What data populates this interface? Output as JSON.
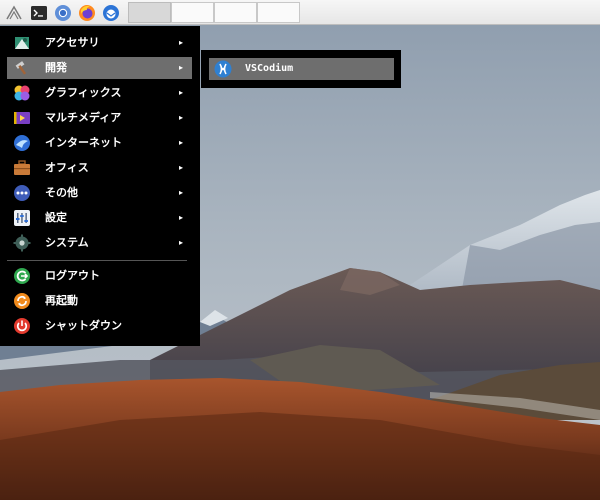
{
  "taskbar": {
    "launchers": [
      {
        "icon": "lxqt-logo-icon"
      },
      {
        "icon": "terminal-icon"
      },
      {
        "icon": "chromium-icon"
      },
      {
        "icon": "firefox-icon"
      },
      {
        "icon": "thunderbird-icon"
      }
    ],
    "tasks": [
      {
        "state": "active"
      },
      {
        "state": "inactive"
      },
      {
        "state": "inactive"
      },
      {
        "state": "inactive"
      }
    ]
  },
  "menu": {
    "items": [
      {
        "label": "アクセサリ",
        "icon": "accessories-icon",
        "submenu": true
      },
      {
        "label": "開発",
        "icon": "development-hammer-icon",
        "submenu": true,
        "selected": true
      },
      {
        "label": "グラフィックス",
        "icon": "graphics-icon",
        "submenu": true
      },
      {
        "label": "マルチメディア",
        "icon": "multimedia-icon",
        "submenu": true
      },
      {
        "label": "インターネット",
        "icon": "internet-icon",
        "submenu": true
      },
      {
        "label": "オフィス",
        "icon": "office-briefcase-icon",
        "submenu": true
      },
      {
        "label": "その他",
        "icon": "other-icon",
        "submenu": true
      },
      {
        "label": "設定",
        "icon": "settings-icon",
        "submenu": true
      },
      {
        "label": "システム",
        "icon": "system-gear-icon",
        "submenu": true
      },
      {
        "label": "ログアウト",
        "icon": "logout-icon",
        "submenu": false
      },
      {
        "label": "再起動",
        "icon": "reboot-icon",
        "submenu": false
      },
      {
        "label": "シャットダウン",
        "icon": "shutdown-icon",
        "submenu": false
      }
    ],
    "arrow": "▸"
  },
  "submenu": {
    "items": [
      {
        "label": "VSCodium",
        "icon": "vscodium-icon"
      }
    ]
  },
  "colors": {
    "menu_bg": "#000000",
    "highlight": "#6e6e6e",
    "text": "#ffffff"
  }
}
